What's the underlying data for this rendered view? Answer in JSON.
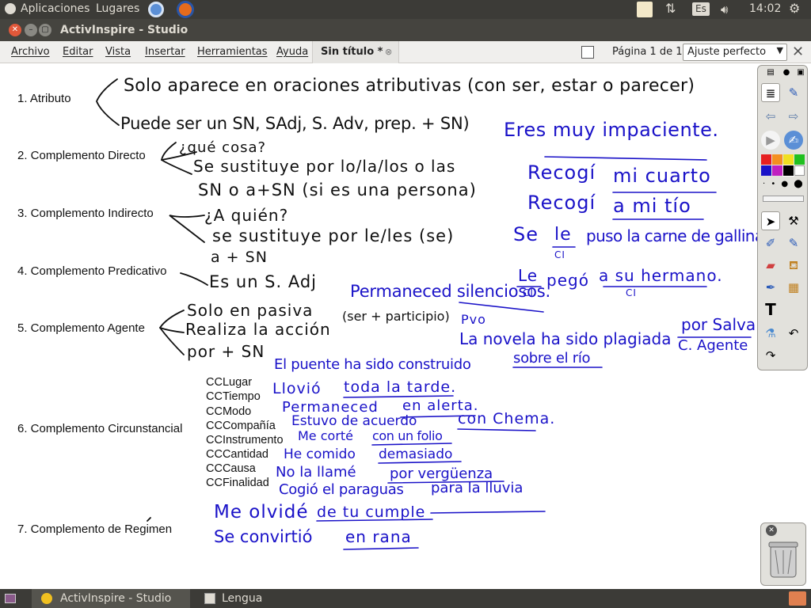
{
  "topbar": {
    "applications": "Aplicaciones",
    "places": "Lugares",
    "keyboard": "Es",
    "clock": "14:02"
  },
  "window": {
    "title": "ActivInspire - Studio"
  },
  "menu": {
    "items": [
      "Archivo",
      "Editar",
      "Vista",
      "Insertar",
      "Herramientas",
      "Ayuda"
    ],
    "tab": "Sin título *",
    "page_label": "Página 1 de 1",
    "zoom": "Ajuste perfecto"
  },
  "labels": {
    "l1": "1. Atributo",
    "l2": "2. Complemento Directo",
    "l3": "3. Complemento Indirecto",
    "l4": "4. Complemento Predicativo",
    "l5": "5. Complemento Agente",
    "l6": "6. Complemento Circunstancial",
    "l7": "7. Complemento de Regimen"
  },
  "cc_types": [
    "CCLugar",
    "CCTiempo",
    "CCModo",
    "CCCompañía",
    "CCInstrumento",
    "CCCantidad",
    "CCCausa",
    "CCFinalidad"
  ],
  "handwriting": {
    "h1": "Solo aparece en oraciones atributivas (con ser, estar o parecer)",
    "h2": "Puede ser un SN, SAdj, S. Adv, prep. + SN)",
    "h3": "¿qué cosa?",
    "h4": "Se sustituye por lo/la/los o las",
    "h5": "SN  o  a+SN (si es una persona)",
    "h6": "¿A quién?",
    "h7": "se sustituye por le/les (se)",
    "h8": "a + SN",
    "h9": "Es un S. Adj",
    "h10": "Solo en pasiva",
    "h11": "Realiza la acción",
    "h12": "(ser + participio)",
    "h13": "por + SN"
  },
  "examples": {
    "e1": "Eres muy impaciente.",
    "e2a": "Recogí",
    "e2b": "mi cuarto",
    "e3a": "Recogí",
    "e3b": "a mi tío",
    "e4a": "Se",
    "e4b": "le",
    "e4c": "puso la carne de gallina",
    "e4d": "CI",
    "e5a": "Le",
    "e5b": "pegó",
    "e5c": "a su hermano.",
    "e5d": "CI",
    "e5e": "CI",
    "e6": "Permaneced silenciosos.",
    "e7": "Pvo",
    "e8a": "La novela ha sido plagiada",
    "e8b": "por Salva",
    "e8c": "C. Agente",
    "e9a": "El puente ha sido construido",
    "e9b": "sobre el río",
    "e10a": "Llovió",
    "e10b": "toda la tarde.",
    "e11a": "Permaneced",
    "e11b": "en alerta.",
    "e12a": "Estuvo de acuerdo",
    "e12b": "con Chema.",
    "e13a": "Me corté",
    "e13b": "con un folio",
    "e14a": "He comido",
    "e14b": "demasiado",
    "e15a": "No la llamé",
    "e15b": "por vergüenza",
    "e16a": "Cogió el paraguas",
    "e16b": "para la lluvia",
    "e17a": "Me olvidé",
    "e17b": "de tu cumple",
    "e18a": "Se convirtió",
    "e18b": "en rana"
  },
  "taskbar": {
    "task1": "ActivInspire - Studio",
    "task2": "Lengua"
  },
  "colors": {
    "ink_black": "#101010",
    "ink_blue": "#1a12c8",
    "panel": "#3c3b37"
  }
}
